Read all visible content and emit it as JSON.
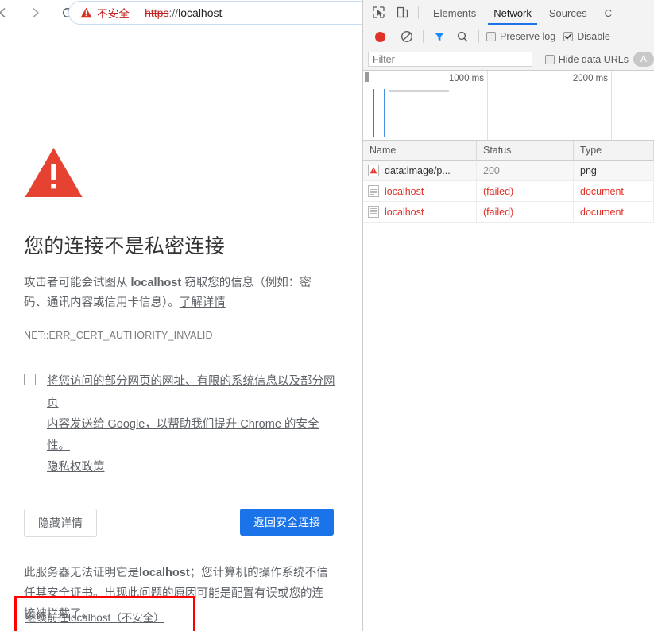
{
  "browser": {
    "nav": {
      "back_icon": "arrow-left-icon",
      "forward_icon": "arrow-right-icon",
      "reload_icon": "reload-icon"
    },
    "omnibox": {
      "warning_icon": "warning-triangle-icon",
      "security_label": "不安全",
      "url_scheme": "https",
      "url_separator": "://",
      "url_host": "localhost",
      "full_url": "https://localhost"
    }
  },
  "error_page": {
    "icon": "large-warning-triangle-icon",
    "title": "您的连接不是私密连接",
    "paragraph_prefix": "攻击者可能会试图从 ",
    "paragraph_host": "localhost",
    "paragraph_middle": " 窃取您的信息（例如：密码、通讯内容或信用卡信息）。",
    "learn_more": "了解详情",
    "error_code": "NET::ERR_CERT_AUTHORITY_INVALID",
    "optin": {
      "checked": false,
      "line1": "将您访问的部分网页的网址、有限的系统信息以及部分网页",
      "line2a": "内容发送给 Google，以帮助我们提升 Chrome 的安全性。",
      "privacy_link": "隐私权政策"
    },
    "buttons": {
      "hide_details": "隐藏详情",
      "back_to_safety": "返回安全连接",
      "primary_color": "#1a73e8"
    },
    "details": {
      "line1_prefix": "此服务器无法证明它是",
      "line1_host": "localhost",
      "line1_suffix": "；您计算机的操作系统",
      "line2": "不信任其安全证书。出现此问题的原因可能是配置有误",
      "line3": "或您的连接被拦截了。"
    },
    "proceed_link": "继续前往localhost（不安全）",
    "highlight_color": "#ff0000"
  },
  "devtools": {
    "toolbar": {
      "inspect_icon": "inspect-element-icon",
      "device_icon": "device-toolbar-icon",
      "tabs": [
        {
          "label": "Elements",
          "active": false
        },
        {
          "label": "Network",
          "active": true
        },
        {
          "label": "Sources",
          "active": false
        },
        {
          "label": "C",
          "active": false
        }
      ]
    },
    "network_toolbar": {
      "record_icon": "record-button-icon",
      "clear_icon": "clear-icon",
      "filter_icon": "filter-funnel-icon",
      "search_icon": "search-icon",
      "preserve_log": {
        "label": "Preserve log",
        "checked": false
      },
      "disable_cache": {
        "label": "Disable",
        "checked": true
      }
    },
    "filter_bar": {
      "filter_placeholder": "Filter",
      "filter_value": "",
      "hide_data_urls": {
        "label": "Hide data URLs",
        "checked": false
      },
      "type_pill": "A"
    },
    "overview": {
      "ticks": [
        "1000 ms",
        "2000 ms"
      ],
      "markers": [
        {
          "name": "dom-content-loaded-marker",
          "color": "#d04a3e"
        },
        {
          "name": "load-event-marker",
          "color": "#4a90e2"
        }
      ],
      "request_bar_color": "#d4d4d4"
    },
    "requests_table": {
      "columns": [
        "Name",
        "Status",
        "Type"
      ],
      "rows": [
        {
          "icon": "warning-resource-icon",
          "name": "data:image/p...",
          "status": "200",
          "type": "png",
          "failed": false
        },
        {
          "icon": "document-resource-icon",
          "name": "localhost",
          "status": "(failed)",
          "type": "document",
          "failed": true
        },
        {
          "icon": "document-resource-icon",
          "name": "localhost",
          "status": "(failed)",
          "type": "document",
          "failed": true
        }
      ]
    }
  }
}
